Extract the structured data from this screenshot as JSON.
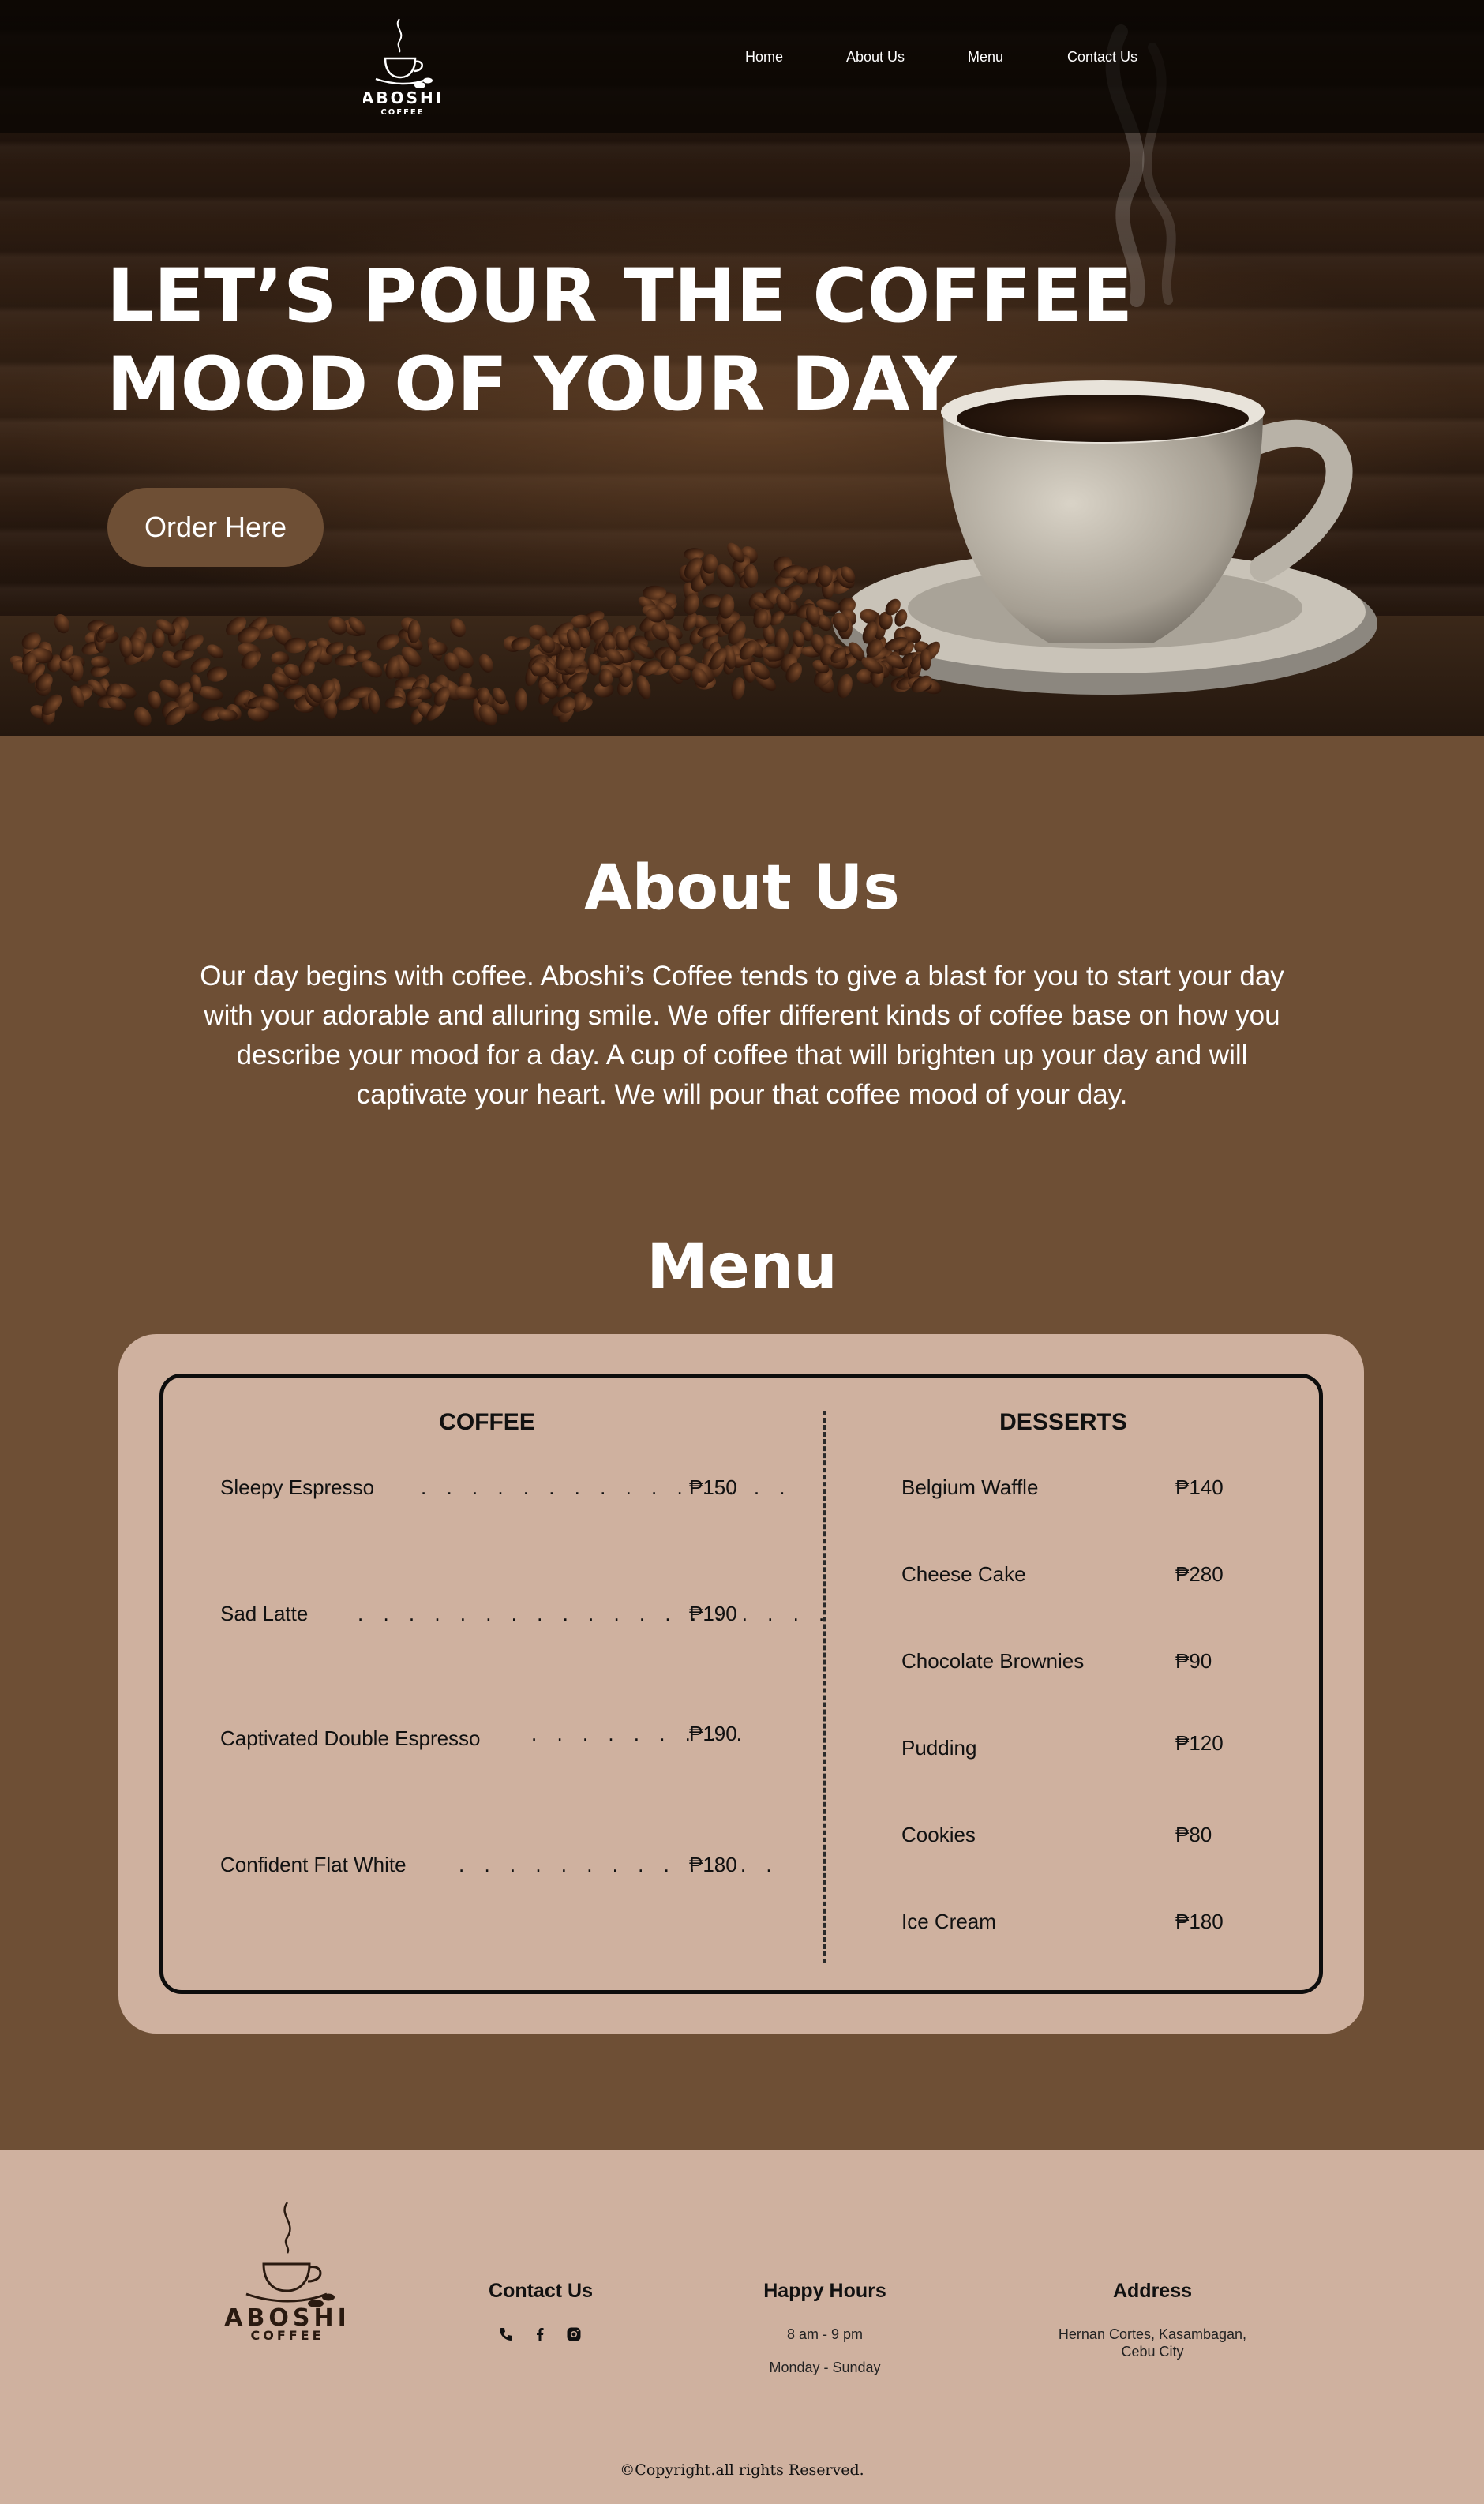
{
  "header": {
    "logo_name": "ABOSHI",
    "logo_sub": "COFFEE",
    "nav": [
      "Home",
      "About Us",
      "Menu",
      "Contact Us"
    ]
  },
  "hero": {
    "title_line1": "LET’S POUR THE COFFEE",
    "title_line2": "MOOD OF YOUR DAY",
    "cta": "Order Here"
  },
  "about": {
    "title": "About Us",
    "lines": [
      "Our day begins with coffee. Aboshi’s Coffee tends to give a blast for you to start your day",
      "with your adorable and alluring smile. We offer different kinds of coffee base on how you",
      "describe your mood for a day. A cup of coffee that will brighten up your day and will",
      "captivate your heart. We will pour that coffee mood of your day."
    ]
  },
  "menu": {
    "title": "Menu",
    "coffee_heading": "COFFEE",
    "desserts_heading": "DESSERTS",
    "coffee": [
      {
        "name": "Sleepy Espresso",
        "price": "₱150"
      },
      {
        "name": "Sad Latte",
        "price": "₱190"
      },
      {
        "name": "Captivated Double Espresso",
        "price": "₱190"
      },
      {
        "name": "Confident Flat White",
        "price": "₱180"
      }
    ],
    "desserts": [
      {
        "name": "Belgium Waffle",
        "price": "₱140"
      },
      {
        "name": "Cheese Cake",
        "price": "₱280"
      },
      {
        "name": "Chocolate Brownies",
        "price": "₱90"
      },
      {
        "name": "Pudding",
        "price": "₱120"
      },
      {
        "name": "Cookies",
        "price": "₱80"
      },
      {
        "name": "Ice Cream",
        "price": "₱180"
      }
    ]
  },
  "footer": {
    "logo_name": "ABOSHI",
    "logo_sub": "COFFEE",
    "contact_title": "Contact Us",
    "contact_icons": [
      "phone-icon",
      "facebook-icon",
      "instagram-icon"
    ],
    "hours_title": "Happy Hours",
    "hours_time": "8 am - 9 pm",
    "hours_days": "Monday - Sunday",
    "address_title": "Address",
    "address_line1": "Hernan Cortes, Kasambagan,",
    "address_line2": "Cebu City",
    "copyright": "©Copyright.all rights Reserved."
  },
  "colors": {
    "brown": "#6e4f35",
    "tan": "#cfb19f",
    "dark": "#111111"
  }
}
